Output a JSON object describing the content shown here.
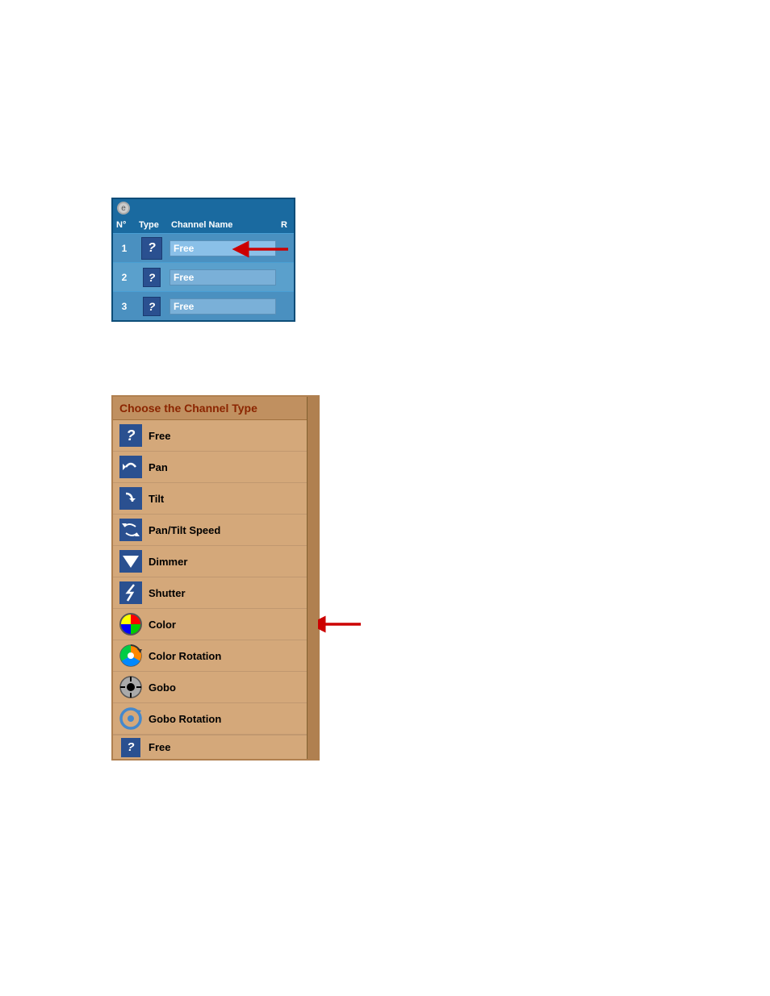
{
  "top_panel": {
    "icon_label": "e",
    "columns": [
      "N°",
      "Type",
      "Channel Name",
      "R"
    ],
    "rows": [
      {
        "num": "1",
        "type_icon": "?",
        "name": "Free"
      },
      {
        "num": "2",
        "type_icon": "?",
        "name": "Free"
      },
      {
        "num": "3",
        "type_icon": "?",
        "name": "Free"
      }
    ]
  },
  "bottom_panel": {
    "title": "Choose the Channel Type",
    "items": [
      {
        "icon": "question",
        "label": "Free"
      },
      {
        "icon": "pan",
        "label": "Pan"
      },
      {
        "icon": "tilt",
        "label": "Tilt"
      },
      {
        "icon": "pantiltspeed",
        "label": "Pan/Tilt Speed"
      },
      {
        "icon": "dimmer",
        "label": "Dimmer"
      },
      {
        "icon": "shutter",
        "label": "Shutter"
      },
      {
        "icon": "color",
        "label": "Color"
      },
      {
        "icon": "color-rotation",
        "label": "Color Rotation"
      },
      {
        "icon": "gobo",
        "label": "Gobo"
      },
      {
        "icon": "gobo-rotation",
        "label": "Gobo Rotation"
      }
    ],
    "partial_item": {
      "icon": "question",
      "label": "Free"
    }
  }
}
